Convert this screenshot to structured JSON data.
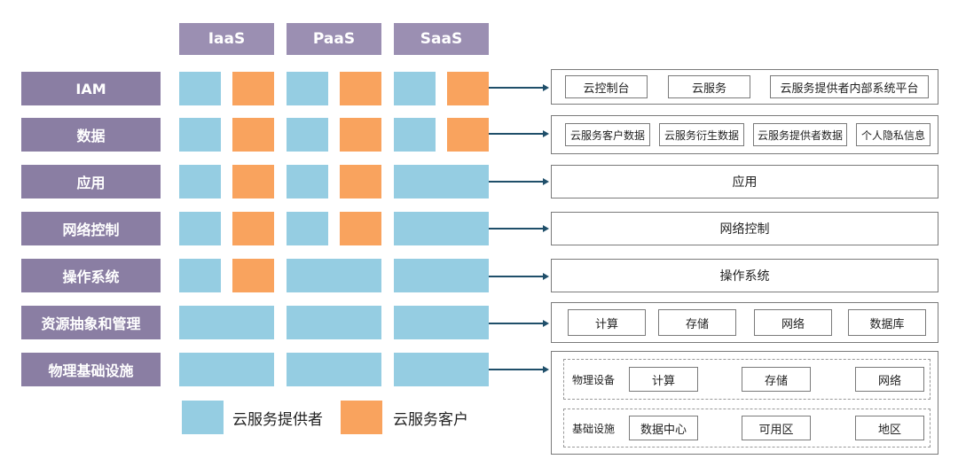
{
  "headers": [
    "IaaS",
    "PaaS",
    "SaaS"
  ],
  "rows": [
    "IAM",
    "数据",
    "应用",
    "网络控制",
    "操作系统",
    "资源抽象和管理",
    "物理基础设施"
  ],
  "legend": {
    "provider": "云服务提供者",
    "customer": "云服务客户"
  },
  "colors": {
    "provider": "#95cde2",
    "customer": "#f9a35e",
    "header": "#9b8fb2",
    "row_label": "#8a7ea3",
    "arrow": "#1f4f6a"
  },
  "panels": {
    "iam": [
      "云控制台",
      "云服务",
      "云服务提供者内部系统平台"
    ],
    "data": [
      "云服务客户数据",
      "云服务衍生数据",
      "云服务提供者数据",
      "个人隐私信息"
    ],
    "app": "应用",
    "network": "网络控制",
    "os": "操作系统",
    "resource": [
      "计算",
      "存储",
      "网络",
      "数据库"
    ],
    "physical": {
      "device_label": "物理设备",
      "device_items": [
        "计算",
        "存储",
        "网络"
      ],
      "infra_label": "基础设施",
      "infra_items": [
        "数据中心",
        "可用区",
        "地区"
      ]
    }
  }
}
